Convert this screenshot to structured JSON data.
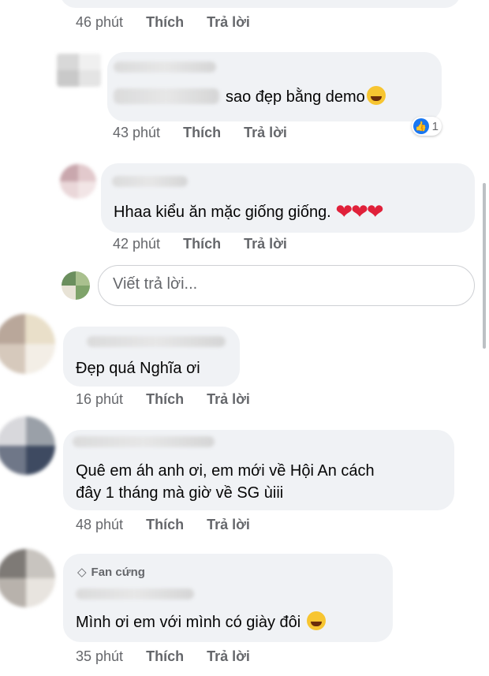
{
  "actions": {
    "like": "Thích",
    "reply": "Trả lời"
  },
  "comments": [
    {
      "time": "46 phút"
    },
    {
      "text_suffix": "sao đẹp bằng demo",
      "emoji": "rolling-laughing-emoji",
      "time": "43 phút",
      "reaction_count": "1"
    },
    {
      "text": "Hhaa kiểu ăn mặc giống giống.",
      "hearts": "❤❤❤",
      "time": "42 phút"
    },
    {
      "text": "Đẹp quá Nghĩa ơi",
      "time": "16 phút"
    },
    {
      "text_line1": "Quê em áh anh ơi, em mới về Hội An cách",
      "text_line2": "đây 1 tháng mà giờ về SG ùiii",
      "time": "48 phút"
    },
    {
      "badge": "Fan cứng",
      "text": "Mình ơi em với mình có giày đôi",
      "emoji": "grinning-squinting-emoji",
      "time": "35 phút"
    }
  ],
  "reply_box": {
    "placeholder": "Viết trả lời..."
  },
  "colors": {
    "bubble": "#f0f2f5",
    "meta": "#65676b",
    "like_blue": "#1877f2",
    "heart": "#e0213a"
  }
}
